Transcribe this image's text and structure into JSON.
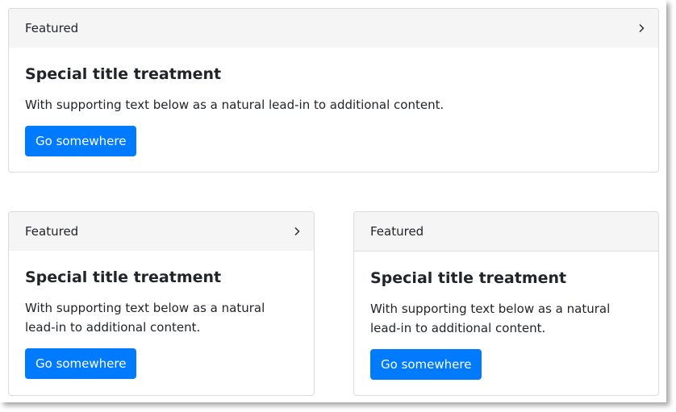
{
  "cards": [
    {
      "header": "Featured",
      "title": "Special title treatment",
      "text": "With supporting text below as a natural lead-in to additional content.",
      "button": "Go somewhere",
      "has_chevron": true
    },
    {
      "header": "Featured",
      "title": "Special title treatment",
      "text": "With supporting text below as a natural lead-in to additional content.",
      "button": "Go somewhere",
      "has_chevron": true
    },
    {
      "header": "Featured",
      "title": "Special title treatment",
      "text": "With supporting text below as a natural lead-in to additional content.",
      "button": "Go somewhere",
      "has_chevron": false
    }
  ],
  "icons": {
    "chevron": "chevron-right-icon"
  },
  "colors": {
    "primary": "#007bff",
    "header_bg": "#f5f5f5",
    "border": "#dcdcdc"
  }
}
